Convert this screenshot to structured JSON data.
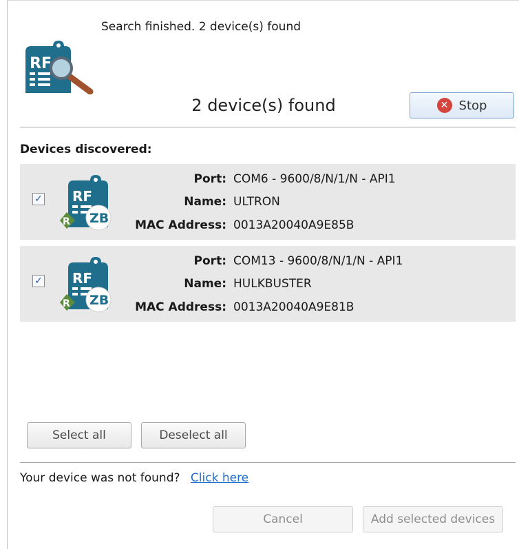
{
  "header": {
    "status": "Search finished. 2 device(s) found",
    "found_title": "2 device(s) found",
    "stop_label": "Stop"
  },
  "section_label": "Devices discovered:",
  "field_labels": {
    "port": "Port:",
    "name": "Name:",
    "mac": "MAC Address:"
  },
  "devices": [
    {
      "checked": true,
      "port": "COM6 - 9600/8/N/1/N - API1",
      "name": "ULTRON",
      "mac": "0013A20040A9E85B"
    },
    {
      "checked": true,
      "port": "COM13 - 9600/8/N/1/N - API1",
      "name": "HULKBUSTER",
      "mac": "0013A20040A9E81B"
    }
  ],
  "buttons": {
    "select_all": "Select all",
    "deselect_all": "Deselect all",
    "cancel": "Cancel",
    "add_selected": "Add selected devices"
  },
  "footer": {
    "not_found_text": "Your device was not found?",
    "click_here": "Click here"
  },
  "icons": {
    "app": "rf-search-icon",
    "device": "rf-zigbee-device-icon",
    "stop": "stop-x-icon"
  },
  "colors": {
    "accent": "#1e6e8c",
    "link": "#1f6fd0",
    "stop": "#d6453d",
    "zb_badge": "#1e6e8c",
    "r_badge": "#5b8c3a"
  }
}
